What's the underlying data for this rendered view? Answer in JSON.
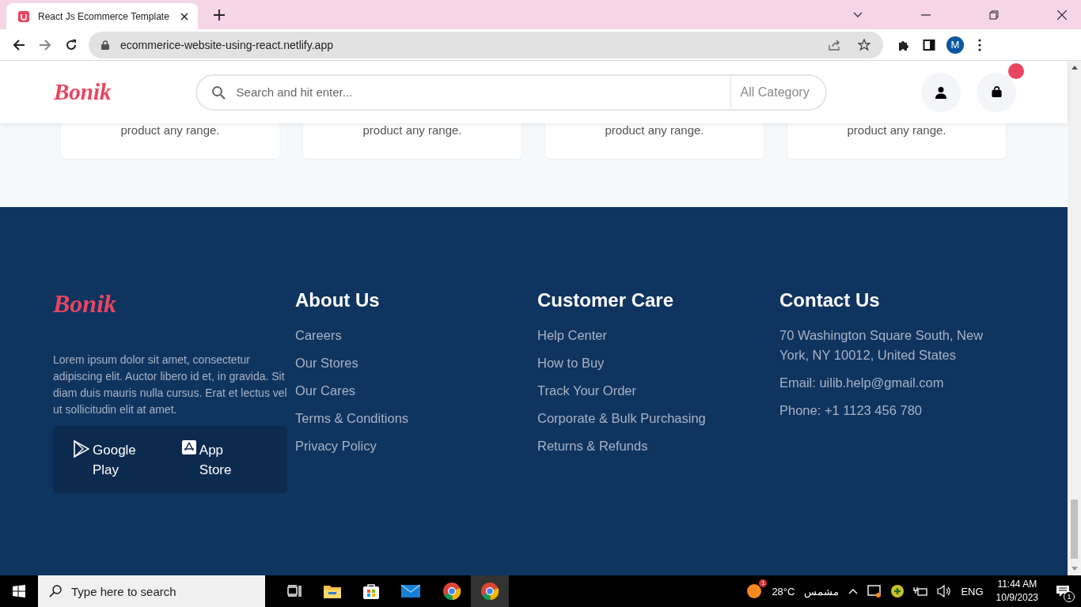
{
  "browser": {
    "tab": {
      "title": "React Js Ecommerce Template",
      "selected": true
    },
    "url": "ecommerice-website-using-react.netlify.app",
    "profile": "M"
  },
  "header": {
    "logo": "Bonik",
    "search": {
      "placeholder": "Search and hit enter..."
    },
    "category": "All Category",
    "cart_badge": true
  },
  "cards": [
    "product any range.",
    "product any range.",
    "product any range.",
    "product any range."
  ],
  "footer": {
    "logo": "Bonik",
    "description": "Lorem ipsum dolor sit amet, consectetur adipiscing elit. Auctor libero id et, in gravida. Sit diam duis mauris nulla cursus. Erat et lectus vel ut sollicitudin elit at amet.",
    "apps": [
      {
        "kind": "play",
        "line1": "Google",
        "line2": "Play"
      },
      {
        "kind": "apple",
        "line1": "App",
        "line2": "Store"
      }
    ],
    "columns": [
      {
        "title": "About Us",
        "links": [
          "Careers",
          "Our Stores",
          "Our Cares",
          "Terms & Conditions",
          "Privacy Policy"
        ]
      },
      {
        "title": "Customer Care",
        "links": [
          "Help Center",
          "How to Buy",
          "Track Your Order",
          "Corporate & Bulk Purchasing",
          "Returns & Refunds"
        ]
      },
      {
        "title": "Contact Us",
        "links": [
          "70 Washington Square South, New York, NY 10012, United States",
          "Email: uilib.help@gmail.com",
          "Phone: +1 1123 456 780"
        ]
      }
    ]
  },
  "taskbar": {
    "search": {
      "placeholder": "Type here to search"
    },
    "weather": {
      "temp": "28°C",
      "condition": "مشمس",
      "badge": "1"
    },
    "language": "ENG",
    "time": "11:44 AM",
    "date": "10/9/2023",
    "notifications": "1"
  }
}
